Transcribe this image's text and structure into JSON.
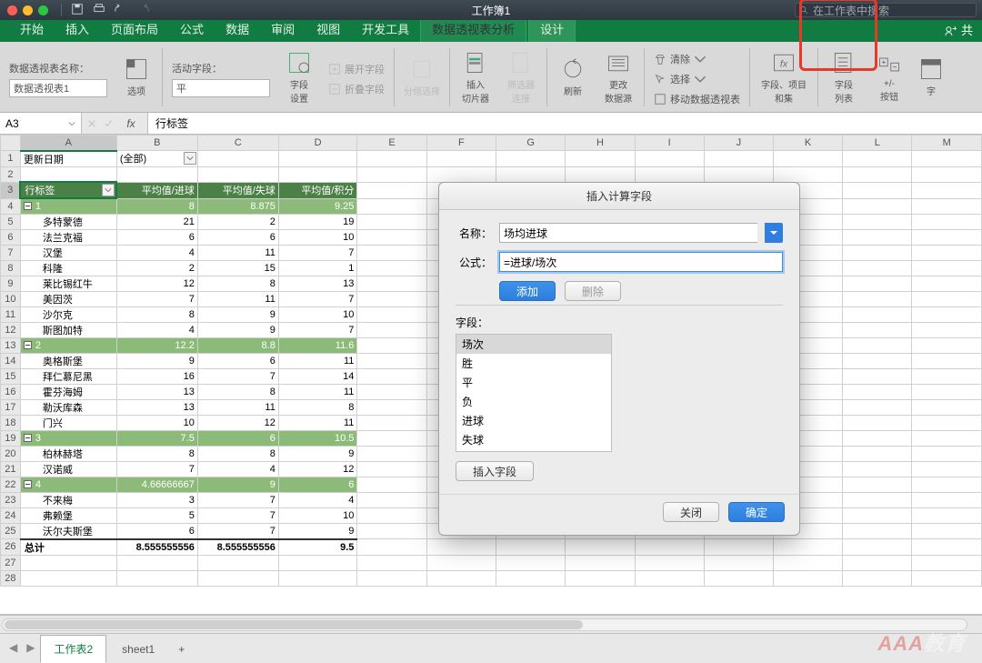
{
  "title": "工作簿1",
  "search_placeholder": "在工作表中搜索",
  "tabs": {
    "items": [
      "开始",
      "插入",
      "页面布局",
      "公式",
      "数据",
      "审阅",
      "视图",
      "开发工具",
      "数据透视表分析",
      "设计"
    ],
    "active_index": 8,
    "right": "共"
  },
  "ribbon": {
    "pt_name_label": "数据透视表名称：",
    "pt_name_value": "数据透视表1",
    "options": "选项",
    "active_field_label": "活动字段：",
    "active_field_value": "平",
    "field_settings": "字段\n设置",
    "expand_field": "展开字段",
    "collapse_field": "折叠字段",
    "group_select": "分组选择",
    "insert_slicer": "插入\n切片器",
    "filter_connect": "筛选器\n连接",
    "refresh": "刷新",
    "change_source": "更改\n数据源",
    "clear": "清除",
    "select": "选择",
    "move_pivot": "移动数据透视表",
    "fx_group": "字段、项目\n和集",
    "field_list": "字段\n列表",
    "plusminus": "+/-\n按钮",
    "field_headers": "字"
  },
  "formula": {
    "namebox": "A3",
    "fx": "fx",
    "content": "行标签"
  },
  "columns": [
    "A",
    "B",
    "C",
    "D",
    "E",
    "F",
    "G",
    "H",
    "I",
    "J",
    "K",
    "L",
    "M"
  ],
  "filter_row": {
    "label": "更新日期",
    "value": "(全部)"
  },
  "headers": [
    "行标签",
    "平均值/进球",
    "平均值/失球",
    "平均值/积分"
  ],
  "groups": [
    {
      "key": "1",
      "avg": [
        "8",
        "8.875",
        "9.25"
      ],
      "rows": [
        [
          "多特蒙德",
          "21",
          "2",
          "19"
        ],
        [
          "法兰克福",
          "6",
          "6",
          "10"
        ],
        [
          "汉堡",
          "4",
          "11",
          "7"
        ],
        [
          "科隆",
          "2",
          "15",
          "1"
        ],
        [
          "莱比锡红牛",
          "12",
          "8",
          "13"
        ],
        [
          "美因茨",
          "7",
          "11",
          "7"
        ],
        [
          "沙尔克",
          "8",
          "9",
          "10"
        ],
        [
          "斯图加特",
          "4",
          "9",
          "7"
        ]
      ]
    },
    {
      "key": "2",
      "avg": [
        "12.2",
        "8.8",
        "11.6"
      ],
      "rows": [
        [
          "奥格斯堡",
          "9",
          "6",
          "11"
        ],
        [
          "拜仁慕尼黑",
          "16",
          "7",
          "14"
        ],
        [
          "霍芬海姆",
          "13",
          "8",
          "11"
        ],
        [
          "勒沃库森",
          "13",
          "11",
          "8"
        ],
        [
          "门兴",
          "10",
          "12",
          "11"
        ]
      ]
    },
    {
      "key": "3",
      "avg": [
        "7.5",
        "6",
        "10.5"
      ],
      "rows": [
        [
          "柏林赫塔",
          "8",
          "8",
          "9"
        ],
        [
          "汉诺威",
          "7",
          "4",
          "12"
        ]
      ]
    },
    {
      "key": "4",
      "avg": [
        "4.66666667",
        "9",
        "6"
      ],
      "rows": [
        [
          "不来梅",
          "3",
          "7",
          "4"
        ],
        [
          "弗赖堡",
          "5",
          "7",
          "10"
        ],
        [
          "沃尔夫斯堡",
          "6",
          "7",
          "9"
        ]
      ]
    }
  ],
  "total": {
    "label": "总计",
    "vals": [
      "8.555555556",
      "8.555555556",
      "9.5"
    ]
  },
  "dialog": {
    "title": "插入计算字段",
    "name_label": "名称：",
    "name_value": "场均进球",
    "formula_label": "公式：",
    "formula_value": "=进球/场次",
    "add": "添加",
    "delete": "删除",
    "fields_label": "字段：",
    "fields": [
      "场次",
      "胜",
      "平",
      "负",
      "进球",
      "失球"
    ],
    "insert_field": "插入字段",
    "close": "关闭",
    "ok": "确定"
  },
  "sheets": {
    "items": [
      "工作表2",
      "sheet1"
    ],
    "active": 0,
    "add": "+"
  },
  "watermark": "AAA教育"
}
